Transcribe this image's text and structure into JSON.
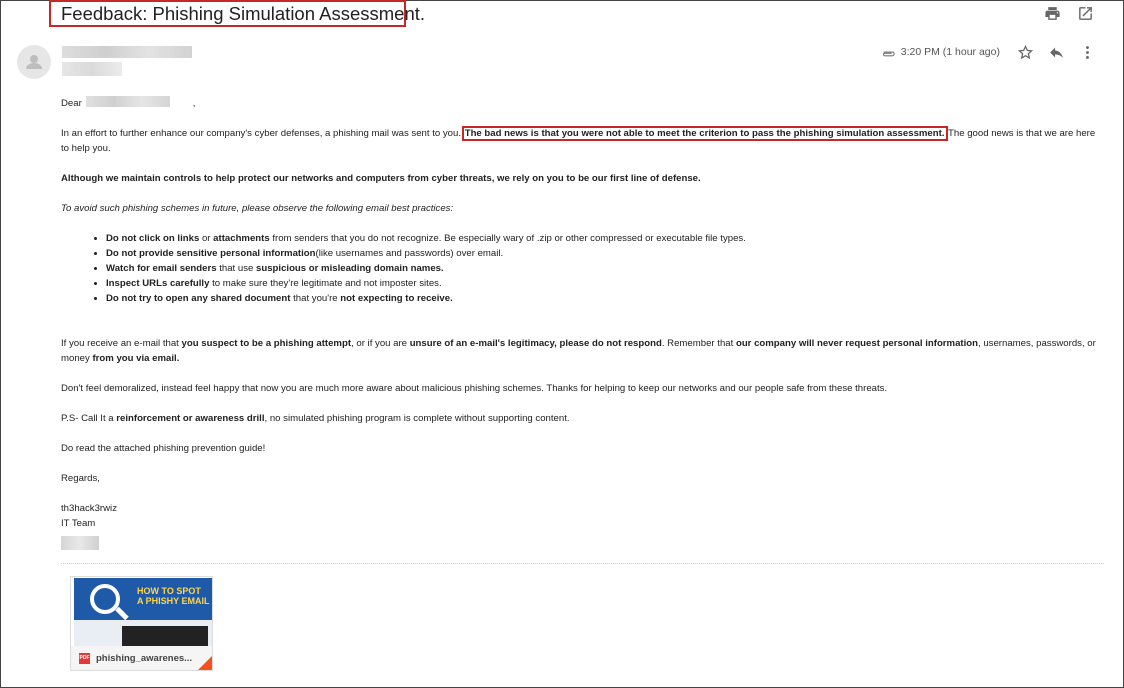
{
  "subject": "Feedback: Phishing Simulation Assessment.",
  "header": {
    "time": "3:20 PM (1 hour ago)"
  },
  "body": {
    "greeting_prefix": "Dear",
    "greeting_suffix": ",",
    "intro_a": "In an effort to further enhance our company's cyber defenses, a phishing mail was sent to you.",
    "intro_highlight": "The bad news is that you were not able to meet the criterion to pass the phishing simulation assessment.",
    "intro_b": "The good news is that we are here to help you.",
    "defense_line": "Although we maintain controls to help protect our networks and computers from cyber threats, we rely on you to be our first line of defense.",
    "practices_intro": "To avoid such phishing schemes in future, please observe the following email best practices:",
    "bullets": [
      {
        "b1": "Do not click on links",
        "t1": " or ",
        "b2": "attachments",
        "t2": " from senders that you do not recognize. Be especially wary of .zip or other compressed or executable file types."
      },
      {
        "b1": "Do not provide sensitive personal information",
        "t1": "(like usernames and passwords) over email.",
        "b2": "",
        "t2": ""
      },
      {
        "b1": "Watch for email senders",
        "t1": " that use ",
        "b2": "suspicious or misleading domain names.",
        "t2": ""
      },
      {
        "b1": "Inspect URLs carefully",
        "t1": " to make sure they're legitimate and not imposter sites.",
        "b2": "",
        "t2": ""
      },
      {
        "b1": "Do not try to open any shared document",
        "t1": " that you're ",
        "b2": "not expecting to receive.",
        "t2": ""
      }
    ],
    "suspect": {
      "s1": "If you receive an e-mail that ",
      "s2": "you suspect to be a phishing attempt",
      "s3": ", or if you are ",
      "s4": "unsure of an e-mail's legitimacy, please do not respond",
      "s5": ". Remember that ",
      "s6": "our company will never request personal information",
      "s7": ", usernames, passwords, or money ",
      "s8": "from you via email."
    },
    "demoralized": "Don't feel demoralized, instead feel happy that now you are much more aware about malicious phishing schemes. Thanks for helping to keep our networks and our people safe from these threats.",
    "ps_a": "P.S- Call It a ",
    "ps_b": "reinforcement or awareness drill",
    "ps_c": ", no simulated phishing program is complete without supporting content.",
    "guide": "Do read the attached phishing prevention guide!",
    "regards": "Regards,",
    "signature_name": "th3hack3rwiz",
    "signature_team": "IT Team"
  },
  "attachment": {
    "filename": "phishing_awarenes...",
    "badge": "PDF",
    "thumb_title_1": "HOW TO SPOT",
    "thumb_title_2": "A PHISHY EMAIL"
  },
  "icons": {
    "print": "print-icon",
    "open": "open-in-new-icon",
    "attach": "paperclip-icon",
    "star": "star-icon",
    "reply": "reply-icon",
    "more": "more-vert-icon",
    "avatar": "person-icon"
  },
  "colors": {
    "highlight_box": "#c62828",
    "pdf": "#e53935"
  }
}
